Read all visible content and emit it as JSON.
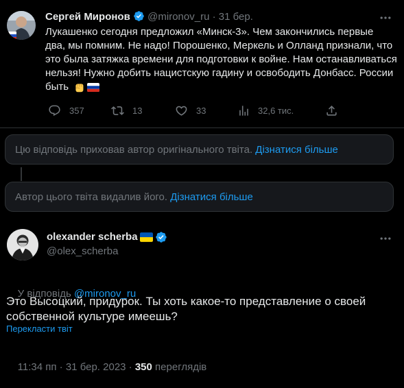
{
  "tweet1": {
    "author_name": "Сергей Миронов",
    "handle": "@mironov_ru",
    "separator": "·",
    "date": "31 бер.",
    "text_lines": [
      "Лукашенко сегодня предложил «Минск-3». Чем закончились первые",
      "два, мы помним. Не надо! Порошенко, Меркель и Олланд признали, что",
      "это была затяжка времени для подготовки к войне. Нам останавливаться",
      "нельзя! Нужно добить нацистскую гадину и освободить Донбасс. России",
      "быть"
    ],
    "emoji": [
      "fist-emoji",
      "russia-flag-emoji"
    ],
    "actions": {
      "replies": "357",
      "reposts": "13",
      "likes": "33",
      "views": "32,6 тис."
    }
  },
  "notice1": {
    "text": "Цю відповідь приховав автор оригінального твіта. ",
    "link": "Дізнатися більше"
  },
  "notice2": {
    "text": "Автор цього твіта видалив його. ",
    "link": "Дізнатися більше"
  },
  "tweet2": {
    "author_name": "olexander scherba",
    "handle": "@olex_scherba",
    "flag_emoji": "ukraine-flag-emoji",
    "reply_prefix": "У відповідь ",
    "reply_to": "@mironov_ru",
    "text_lines": [
      "Это Высоцкий, придурок. Ты хоть какое-то представление о своей",
      "собственной культуре имеешь?"
    ],
    "translate_link": "Перекласти твіт",
    "time": "11:34 пп · 31 бер. 2023 · ",
    "views_count": "350",
    "views_label": " переглядів"
  },
  "colors": {
    "background": "#000000",
    "text": "#e7e9ea",
    "muted": "#71767b",
    "accent": "#1d9bf0",
    "border": "#2f3336",
    "notice_bg": "#16181c"
  }
}
